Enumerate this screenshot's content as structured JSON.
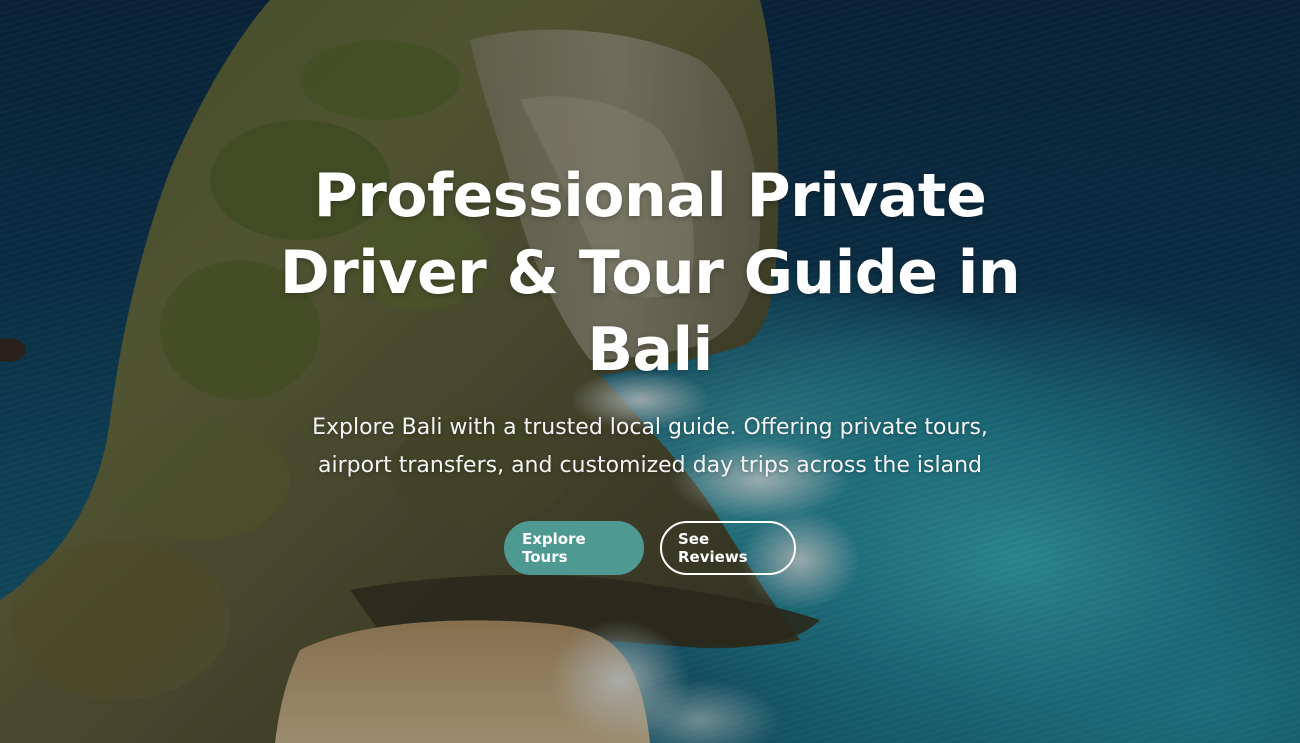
{
  "hero": {
    "background_icon": "coastal-cliff-photo",
    "title": "Professional Private Driver & Tour Guide in Bali",
    "subtitle": "Explore Bali with a trusted local guide. Offering private tours, airport transfers, and customized day trips across the island",
    "buttons": {
      "primary_label": "Explore Tours",
      "secondary_label": "See Reviews"
    },
    "colors": {
      "primary_button": "#4e9a92",
      "text": "#ffffff"
    }
  }
}
